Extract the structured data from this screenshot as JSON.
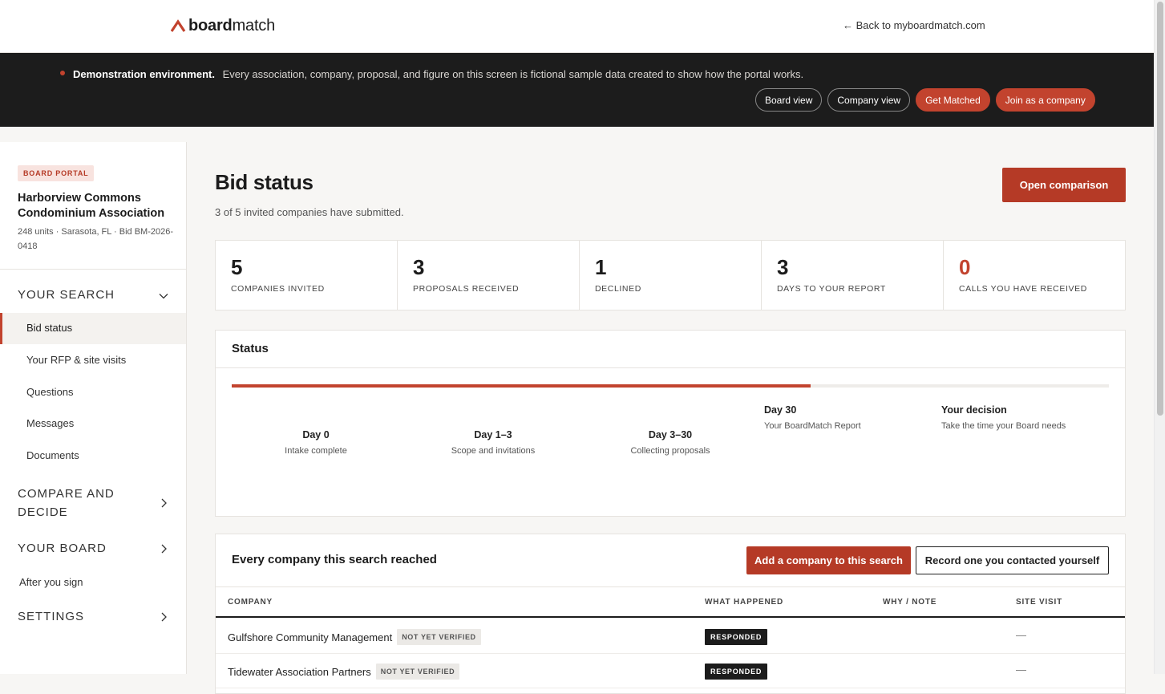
{
  "header": {
    "logo_bold": "board",
    "logo_light": "match",
    "back_link": "← Back to myboardmatch.com"
  },
  "demo_banner": {
    "title": "Demonstration environment.",
    "text": "Every association, company, proposal, and figure on this screen is fictional sample data created to show how the portal works.",
    "buttons": [
      "Board view",
      "Company view",
      "Get Matched",
      "Join as a company"
    ]
  },
  "sidebar": {
    "badge": "BOARD PORTAL",
    "association_name": "Harborview Commons Condominium Association",
    "association_meta": "248 units · Sarasota, FL · Bid BM-2026-0418",
    "sections": [
      {
        "label": "YOUR SEARCH",
        "expanded": true,
        "items": [
          "Bid status",
          "Your RFP & site visits",
          "Questions",
          "Messages",
          "Documents"
        ]
      },
      {
        "label": "COMPARE AND DECIDE",
        "expanded": false
      },
      {
        "label": "YOUR BOARD",
        "expanded": false
      },
      {
        "label": "SETTINGS",
        "expanded": false
      }
    ],
    "after_sign": "After you sign",
    "active_item": "Bid status"
  },
  "main": {
    "title": "Bid status",
    "subtitle": "3 of 5 invited companies have submitted.",
    "open_comparison": "Open comparison",
    "stats": [
      {
        "value": "5",
        "label": "COMPANIES INVITED"
      },
      {
        "value": "3",
        "label": "PROPOSALS RECEIVED"
      },
      {
        "value": "1",
        "label": "DECLINED"
      },
      {
        "value": "3",
        "label": "DAYS TO YOUR REPORT"
      },
      {
        "value": "0",
        "label": "CALLS YOU HAVE RECEIVED",
        "accent": "#c2432e"
      }
    ],
    "status": {
      "title": "Status",
      "progress": 0.66,
      "steps": [
        {
          "day": "Day 0",
          "desc": "Intake complete"
        },
        {
          "day": "Day 1–3",
          "desc": "Scope and invitations"
        },
        {
          "day": "Day 3–30",
          "desc": "Collecting proposals"
        },
        {
          "day": "Day 30",
          "desc": "Your BoardMatch Report"
        },
        {
          "day": "Your decision",
          "desc": "Take the time your Board needs"
        }
      ]
    },
    "companies": {
      "title": "Every company this search reached",
      "add_button": "Add a company to this search",
      "record_button": "Record one you contacted yourself",
      "columns": [
        "COMPANY",
        "WHAT HAPPENED",
        "WHY / NOTE",
        "SITE VISIT"
      ],
      "rows": [
        {
          "company": "Gulfshore Community Management",
          "tag": "NOT YET VERIFIED",
          "status": "RESPONDED",
          "note": "",
          "site_visit": "—"
        },
        {
          "company": "Tidewater Association Partners",
          "tag": "NOT YET VERIFIED",
          "status": "RESPONDED",
          "note": "",
          "site_visit": "—"
        }
      ]
    }
  },
  "colors": {
    "accent": "#c2432e",
    "dark": "#1c1c1c"
  }
}
